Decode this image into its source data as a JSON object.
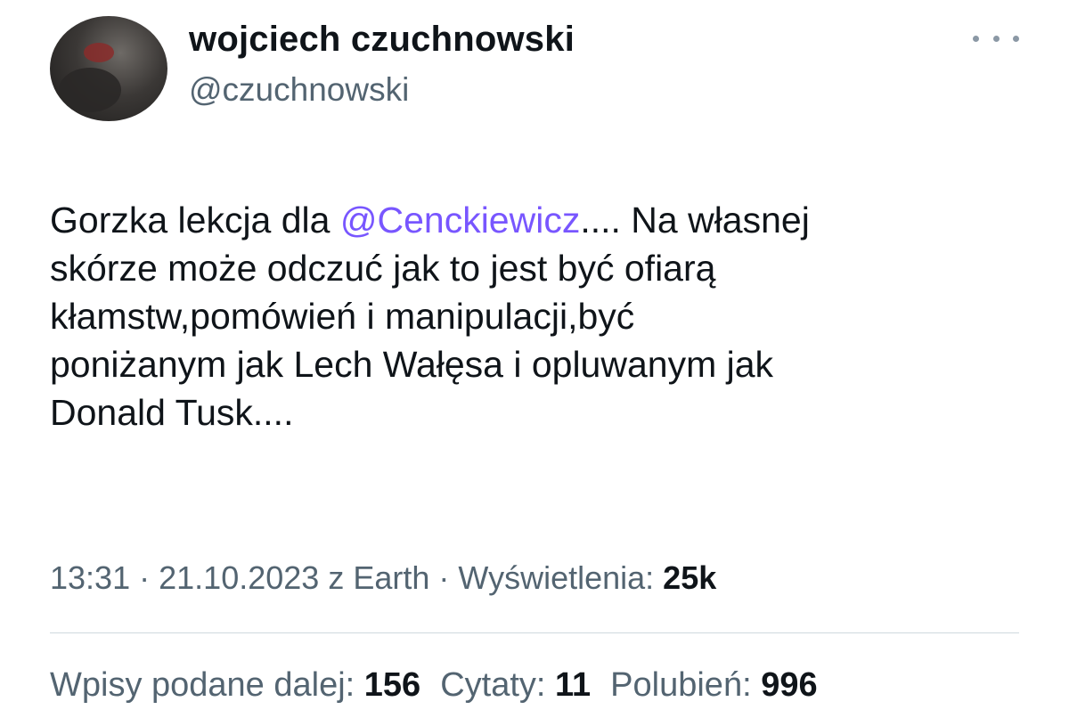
{
  "author": {
    "display_name": "wojciech czuchnowski",
    "handle": "@czuchnowski"
  },
  "tweet": {
    "lines": [
      {
        "before": "Gorzka lekcja dla ",
        "mention": "@Cenckiewicz",
        "after": ".... Na własnej"
      },
      {
        "text": "skórze może odczuć jak to jest być ofiarą"
      },
      {
        "text": "kłamstw,pomówień i manipulacji,być"
      },
      {
        "text": "poniżanym jak Lech Wałęsa i opluwanym jak"
      },
      {
        "text": "Donald Tusk...."
      }
    ]
  },
  "meta": {
    "time": "13:31",
    "date": "21.10.2023",
    "source": "z Earth",
    "views_label": "Wyświetlenia:",
    "views_value": "25k",
    "separator": "·"
  },
  "stats": {
    "reposts_label": "Wpisy podane dalej:",
    "reposts_value": "156",
    "quotes_label": "Cytaty:",
    "quotes_value": "11",
    "likes_label": "Polubień:",
    "likes_value": "996"
  },
  "icons": {
    "more": "more-horizontal-icon"
  },
  "colors": {
    "mention": "#7856ff",
    "secondary_text": "#536471",
    "primary_text": "#0f1419",
    "divider": "#cfd9de"
  }
}
